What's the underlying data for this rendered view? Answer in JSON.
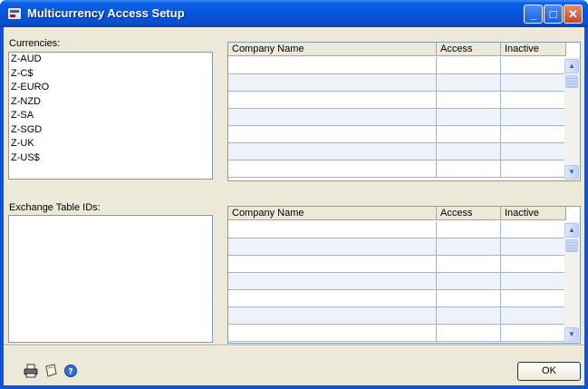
{
  "window": {
    "title": "Multicurrency Access Setup",
    "controls": {
      "minimize": "_",
      "maximize": "□",
      "close": "✕"
    }
  },
  "currencies": {
    "label": "Currencies:",
    "items": [
      "Z-AUD",
      "Z-C$",
      "Z-EURO",
      "Z-NZD",
      "Z-SA",
      "Z-SGD",
      "Z-UK",
      "Z-US$"
    ]
  },
  "exchange_tables": {
    "label": "Exchange Table IDs:",
    "items": []
  },
  "currency_access_grid": {
    "columns": [
      "Company Name",
      "Access",
      "Inactive"
    ],
    "rows": [
      [
        "",
        "",
        ""
      ],
      [
        "",
        "",
        ""
      ],
      [
        "",
        "",
        ""
      ],
      [
        "",
        "",
        ""
      ],
      [
        "",
        "",
        ""
      ],
      [
        "",
        "",
        ""
      ],
      [
        "",
        "",
        ""
      ]
    ]
  },
  "exchange_access_grid": {
    "columns": [
      "Company Name",
      "Access",
      "Inactive"
    ],
    "rows": [
      [
        "",
        "",
        ""
      ],
      [
        "",
        "",
        ""
      ],
      [
        "",
        "",
        ""
      ],
      [
        "",
        "",
        ""
      ],
      [
        "",
        "",
        ""
      ],
      [
        "",
        "",
        ""
      ],
      [
        "",
        "",
        ""
      ]
    ]
  },
  "footer": {
    "icons": [
      "printer-icon",
      "note-icon",
      "help-icon"
    ],
    "ok_label": "OK"
  },
  "colors": {
    "titlebar": "#0653db",
    "client_bg": "#ece9d8",
    "field_border": "#7f9db9"
  }
}
